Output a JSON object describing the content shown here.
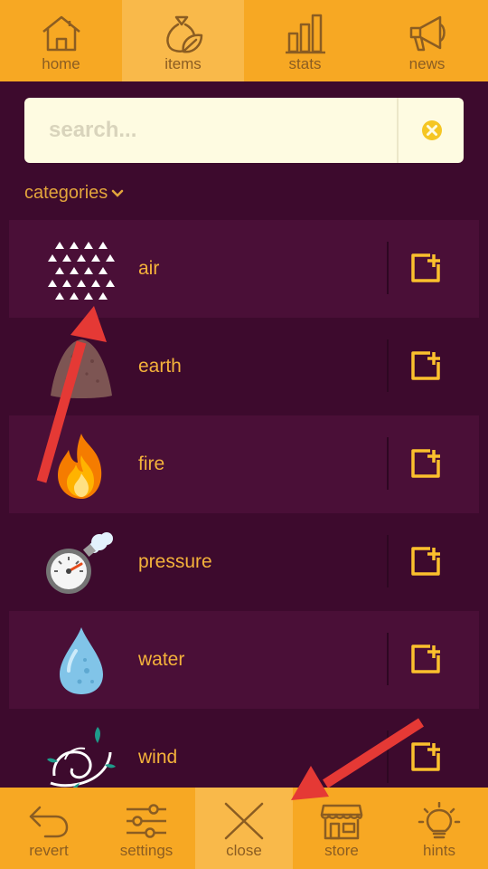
{
  "top_nav": {
    "tabs": [
      {
        "label": "home",
        "icon": "home-icon",
        "active": false
      },
      {
        "label": "items",
        "icon": "items-bag-icon",
        "active": true
      },
      {
        "label": "stats",
        "icon": "stats-bars-icon",
        "active": false
      },
      {
        "label": "news",
        "icon": "megaphone-icon",
        "active": false
      }
    ]
  },
  "search": {
    "placeholder": "search...",
    "value": "",
    "clear_icon": "clear-circle-icon"
  },
  "categories": {
    "label": "categories",
    "icon": "chevron-down-icon"
  },
  "items": [
    {
      "name": "air",
      "icon": "air-triangles-icon"
    },
    {
      "name": "earth",
      "icon": "earth-mound-icon"
    },
    {
      "name": "fire",
      "icon": "fire-icon"
    },
    {
      "name": "pressure",
      "icon": "pressure-gauge-icon"
    },
    {
      "name": "water",
      "icon": "water-drop-icon"
    },
    {
      "name": "wind",
      "icon": "wind-swirl-icon"
    }
  ],
  "bottom_nav": {
    "tabs": [
      {
        "label": "revert",
        "icon": "undo-arrow-icon",
        "active": false
      },
      {
        "label": "settings",
        "icon": "sliders-icon",
        "active": false
      },
      {
        "label": "close",
        "icon": "close-x-icon",
        "active": true
      },
      {
        "label": "store",
        "icon": "storefront-icon",
        "active": false
      },
      {
        "label": "hints",
        "icon": "lightbulb-icon",
        "active": false
      }
    ]
  },
  "colors": {
    "background": "#3d0a2d",
    "row_alt": "#4a0f37",
    "nav_bar": "#f7a823",
    "nav_active": "#f9b94a",
    "nav_icon": "#8b5d22",
    "item_text": "#f4b23b",
    "add_icon": "#fbc02d",
    "search_bg": "#fefbe1",
    "annotation_arrow": "#e53935"
  }
}
